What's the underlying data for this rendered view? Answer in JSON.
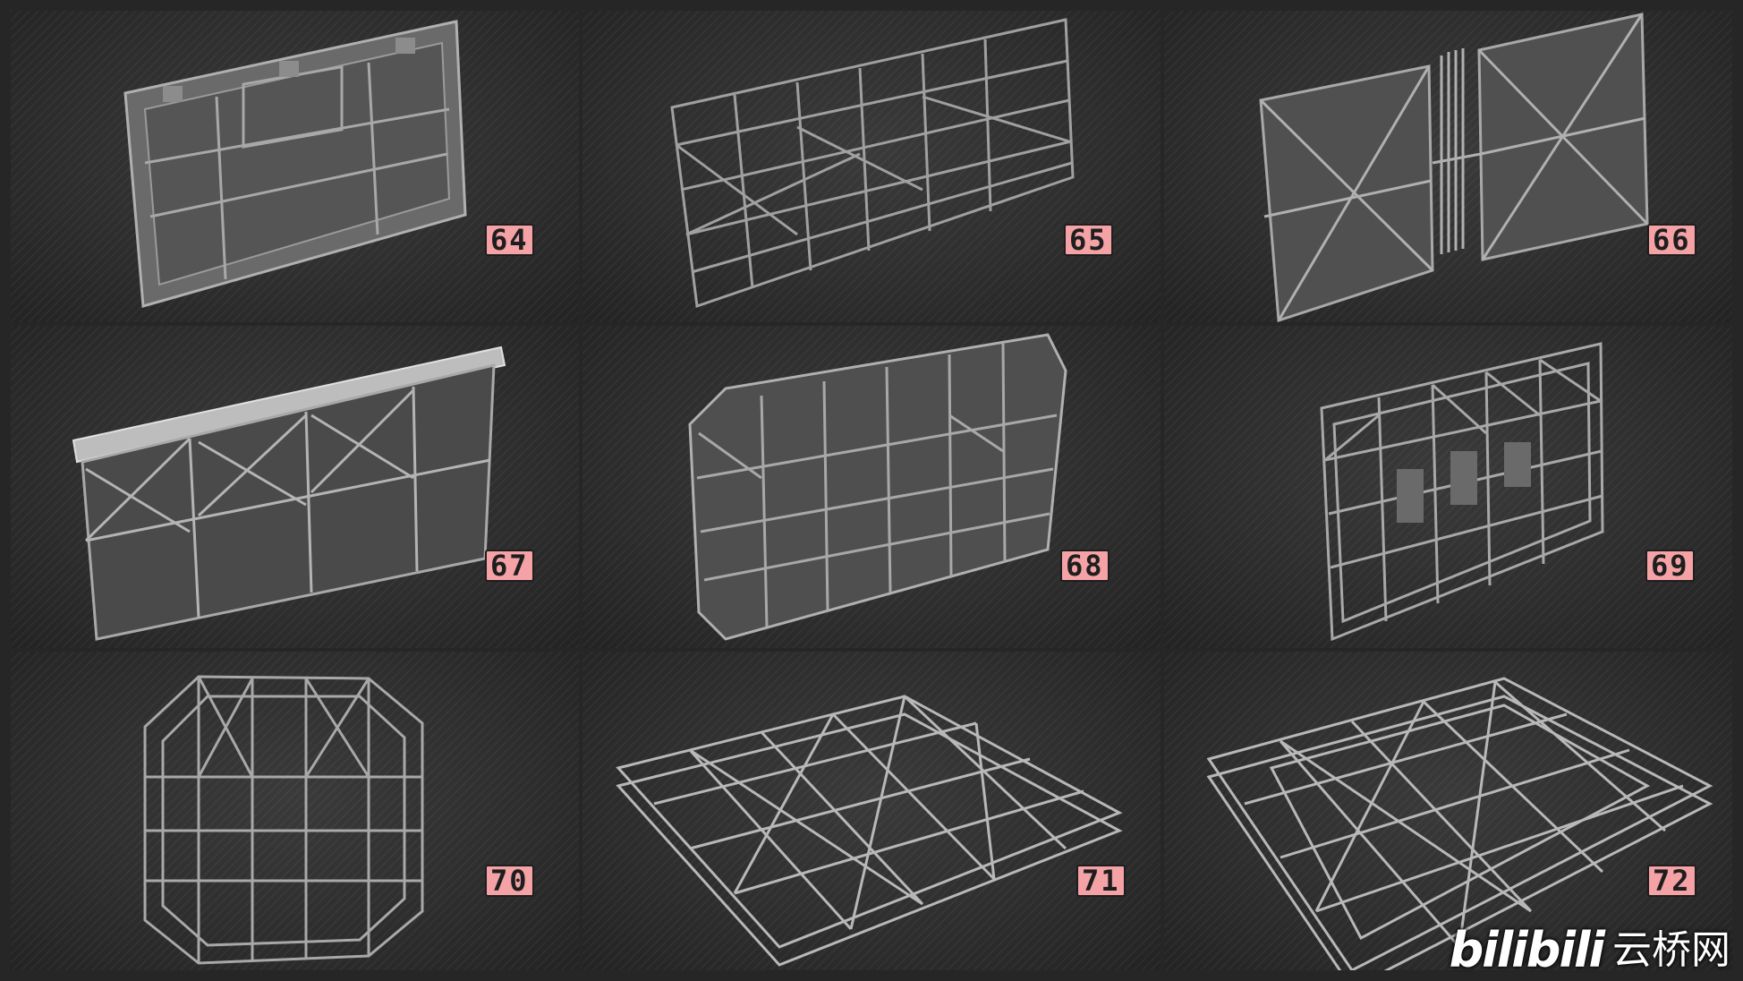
{
  "tiles": [
    {
      "label": "64",
      "icon": "wall-panel-model"
    },
    {
      "label": "65",
      "icon": "scaffold-frame-model"
    },
    {
      "label": "66",
      "icon": "split-panel-pipes-model"
    },
    {
      "label": "67",
      "icon": "beam-frame-wall-model"
    },
    {
      "label": "68",
      "icon": "chamfered-frame-wall-model"
    },
    {
      "label": "69",
      "icon": "layered-lattice-model"
    },
    {
      "label": "70",
      "icon": "cage-frame-model"
    },
    {
      "label": "71",
      "icon": "floor-truss-model"
    },
    {
      "label": "72",
      "icon": "large-floor-truss-model"
    }
  ],
  "watermark": {
    "brand": "bilibili",
    "site": "云桥网"
  },
  "colors": {
    "label_bg": "#f4a2a6",
    "background": "#262626",
    "model": "#8a8a8a"
  }
}
